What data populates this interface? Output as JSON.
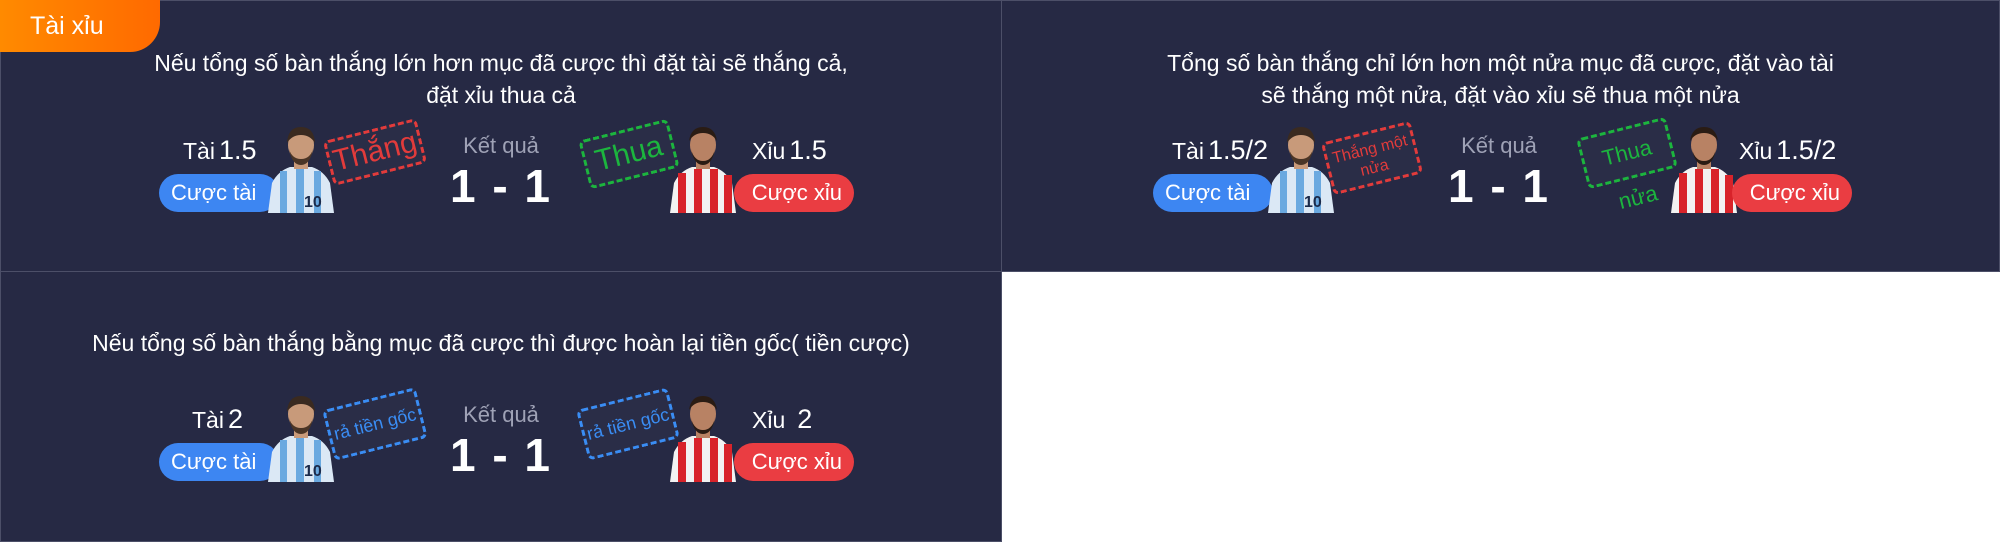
{
  "tab": {
    "label": "Tài xỉu"
  },
  "result_label": "Kết quả",
  "result_score": "1 - 1",
  "buttons": {
    "over": "Cược tài",
    "under": "Cược xỉu"
  },
  "labels": {
    "over": "Tài",
    "under": "Xỉu"
  },
  "panels": [
    {
      "desc_line1": "Nếu tổng số bàn thắng lớn hơn mục đã cược thì đặt tài sẽ thắng cả,",
      "desc_line2": "đặt xỉu thua cả",
      "over_value": "1.5",
      "under_value": "1.5",
      "stamp_left": "Thắng",
      "stamp_right": "Thua"
    },
    {
      "desc_line1": "Tổng số bàn thắng chỉ lớn hơn một nửa mục đã cược, đặt vào tài",
      "desc_line2": "sẽ thắng một nửa, đặt vào xỉu sẽ thua một nửa",
      "over_value": "1.5/2",
      "under_value": "1.5/2",
      "stamp_left": "Thắng một nửa",
      "stamp_right": "Thua nửa"
    },
    {
      "desc_line1": "Nếu tổng số bàn thắng bằng mục đã cược thì được hoàn lại tiền gốc( tiền cược)",
      "over_value": "2",
      "under_value": "2",
      "stamp_left": "rả tiền gốc",
      "stamp_right": "rả tiền gốc"
    }
  ],
  "colors": {
    "panel_bg": "#262944",
    "over_button": "#3d86f2",
    "under_button": "#ea3d42",
    "tab_accent": "#ff7a00",
    "stamp_win": "#e23b3b",
    "stamp_lose": "#1cb53e",
    "stamp_refund": "#3a8df4"
  }
}
